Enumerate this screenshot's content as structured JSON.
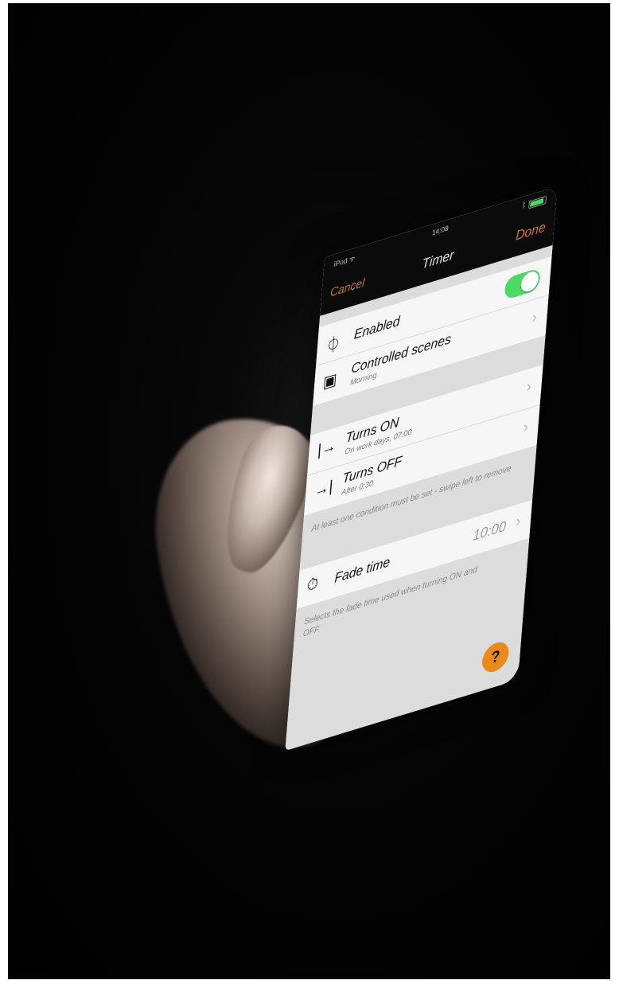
{
  "status": {
    "carrier": "iPod ᯤ",
    "time": "14:08",
    "bluetooth": "ᛒ",
    "battery_level": 0.9
  },
  "nav": {
    "cancel": "Cancel",
    "title": "Timer",
    "done": "Done"
  },
  "rows": {
    "enabled": {
      "icon": "clock-icon",
      "label": "Enabled",
      "toggle_on": true
    },
    "scenes": {
      "icon": "scene-icon",
      "label": "Controlled scenes",
      "sub": "Morning"
    },
    "turns_on": {
      "icon": "arrow-in-icon",
      "label": "Turns ON",
      "sub": "On work days, 07:00"
    },
    "turns_off": {
      "icon": "arrow-out-icon",
      "label": "Turns OFF",
      "sub": "After 0:30"
    },
    "fade": {
      "icon": "stopwatch-icon",
      "label": "Fade time",
      "value": "10:00"
    }
  },
  "notes": {
    "conditions": "At least one condition must be set - swipe left to remove",
    "fade": "Selects the fade time used when turning ON and OFF."
  },
  "help_label": "?",
  "colors": {
    "accent": "#d5782a",
    "toggle": "#4cd964",
    "help": "#e88a1c"
  }
}
